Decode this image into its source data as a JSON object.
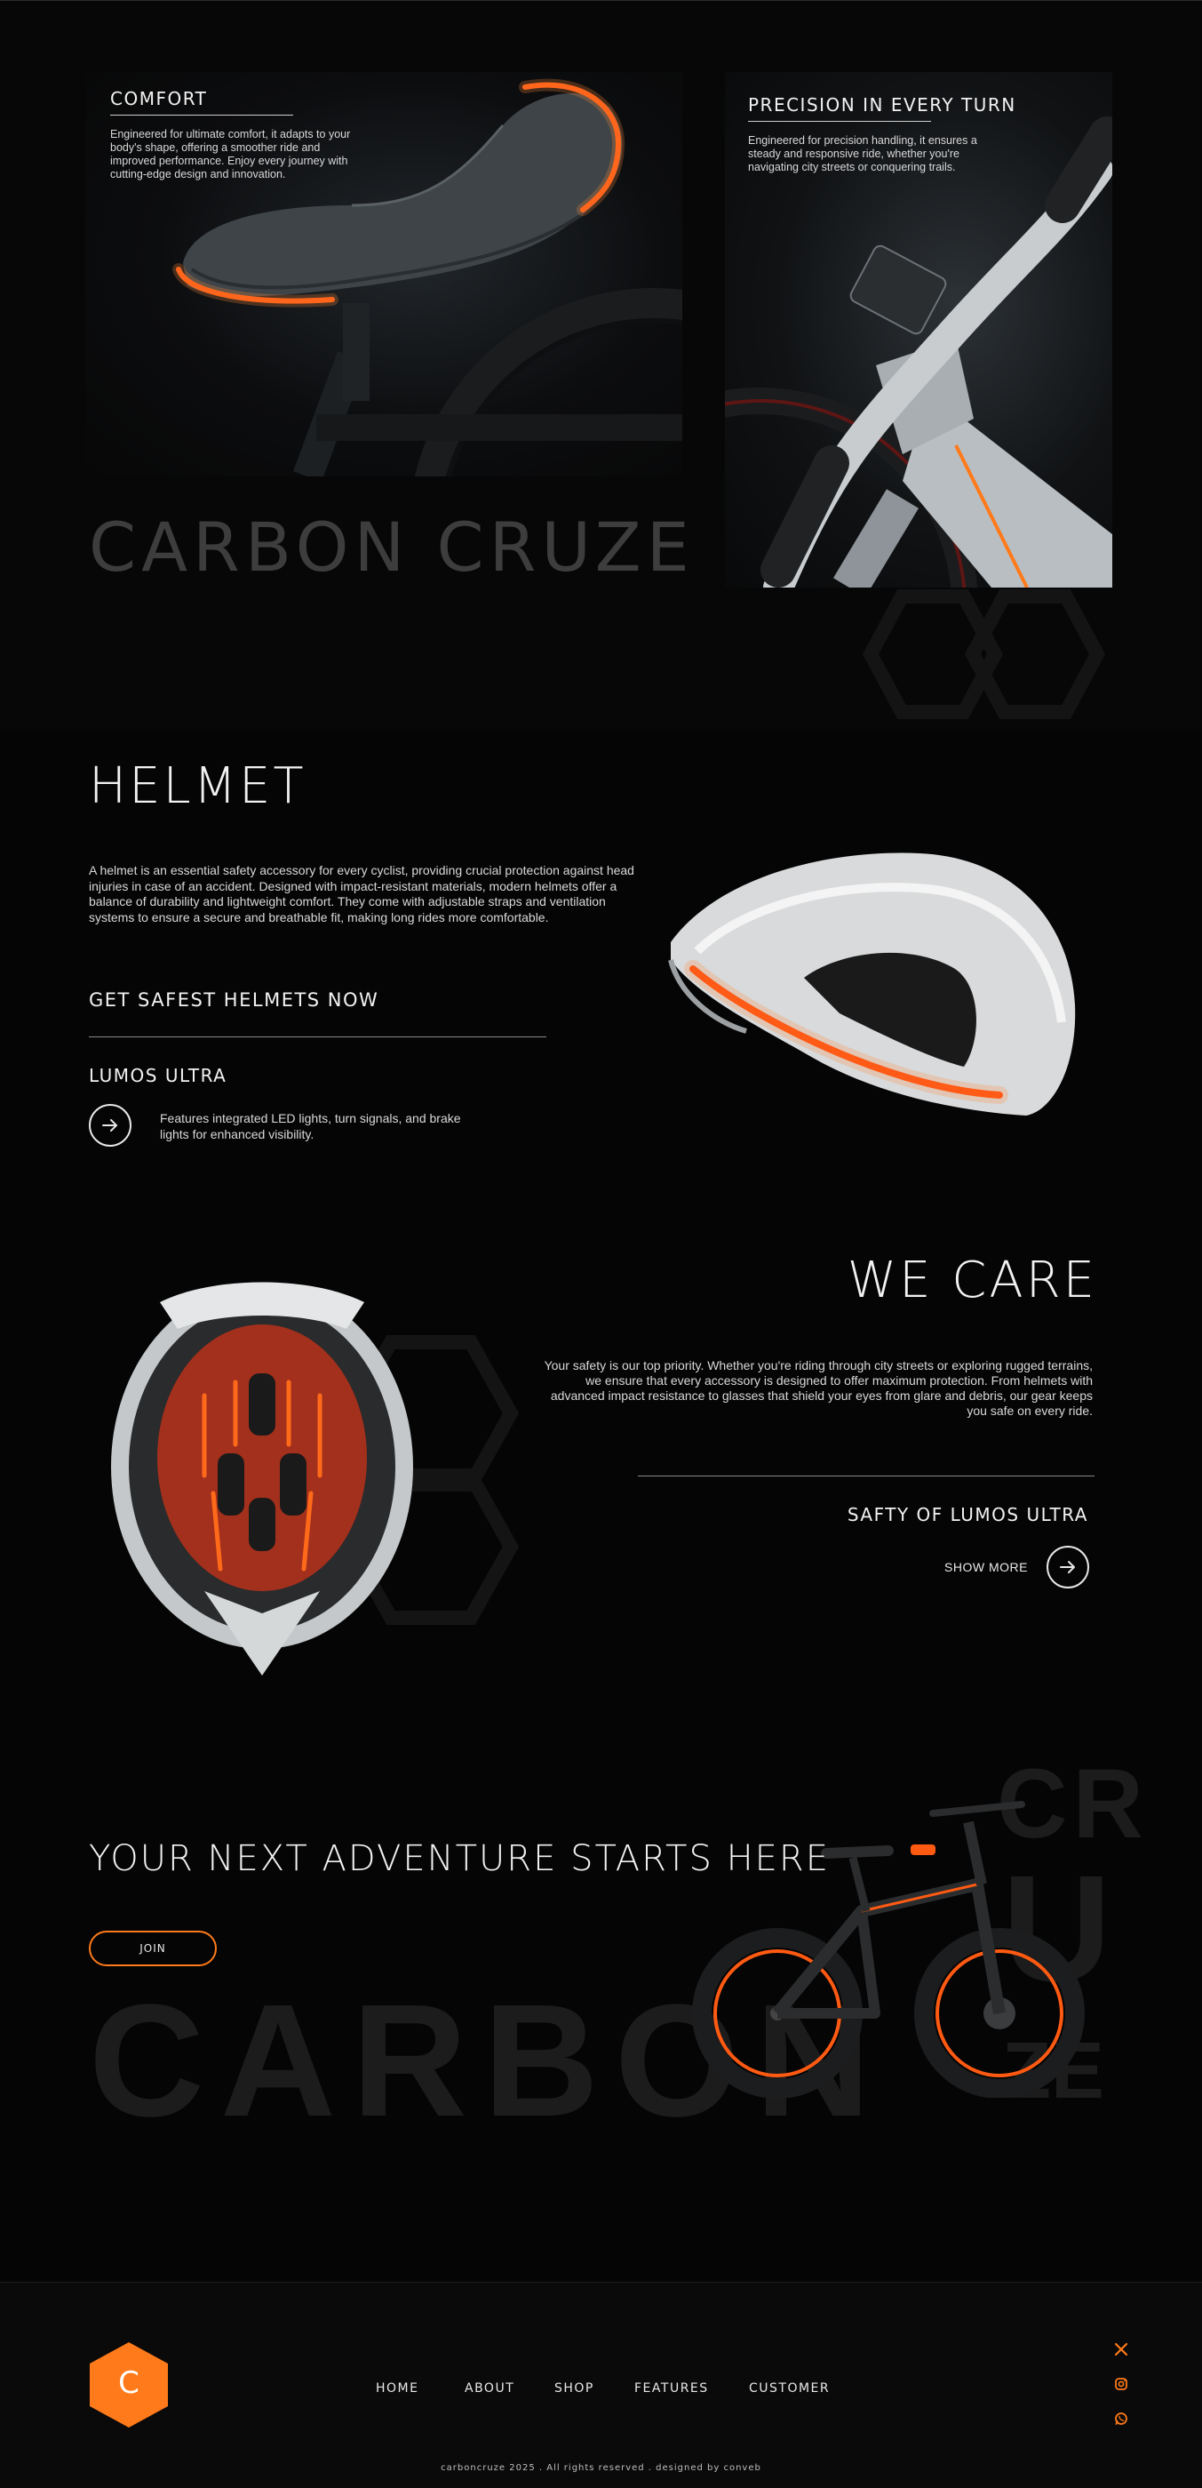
{
  "colors": {
    "accent": "#ff7a1a",
    "background": "#050505",
    "muted_brand": "#3d3d3d"
  },
  "comfort": {
    "title": "COMFORT",
    "text": "Engineered for ultimate comfort, it adapts to your body's shape, offering a smoother ride and improved performance. Enjoy every journey with cutting-edge design and innovation."
  },
  "precision": {
    "title": "PRECISION IN EVERY TURN",
    "text": "Engineered for precision handling, it ensures a steady and responsive ride, whether you're navigating city streets or conquering trails."
  },
  "brand": {
    "name": "CARBON CRUZE"
  },
  "helmet": {
    "title": "HELMET",
    "text": "A helmet is an essential safety accessory for every cyclist, providing crucial protection against head injuries in case of an accident. Designed with impact-resistant materials, modern helmets offer a balance of durability and lightweight comfort. They come with adjustable straps and ventilation systems to ensure a secure and breathable fit, making long rides more comfortable.",
    "cta": "GET SAFEST HELMETS NOW",
    "product_name": "LUMOS ULTRA",
    "product_text": "Features integrated LED lights, turn signals, and brake lights for enhanced visibility."
  },
  "care": {
    "title": "WE CARE",
    "text": "Your safety is our top priority. Whether you're riding through city streets or exploring rugged terrains, we ensure that every accessory is designed to offer maximum protection. From helmets with advanced impact resistance to glasses that shield your eyes from glare and debris, our gear keeps you safe on every ride.",
    "subtitle": "SAFTY OF LUMOS ULTRA",
    "show_more": "SHOW MORE"
  },
  "adventure": {
    "title": "YOUR NEXT ADVENTURE STARTS HERE",
    "join": "JOIN",
    "bg_word": "CARBON",
    "bg_cr": "CR",
    "bg_u": "U",
    "bg_ze": "ZE"
  },
  "footer": {
    "logo_letter": "C",
    "nav": [
      "HOME",
      "ABOUT",
      "SHOP",
      "FEATURES",
      "CUSTOMER"
    ],
    "social_icons": [
      "x-icon",
      "instagram-icon",
      "whatsapp-icon"
    ],
    "copyright": "carboncruze 2025 . All rights reserved . designed by conveb"
  }
}
